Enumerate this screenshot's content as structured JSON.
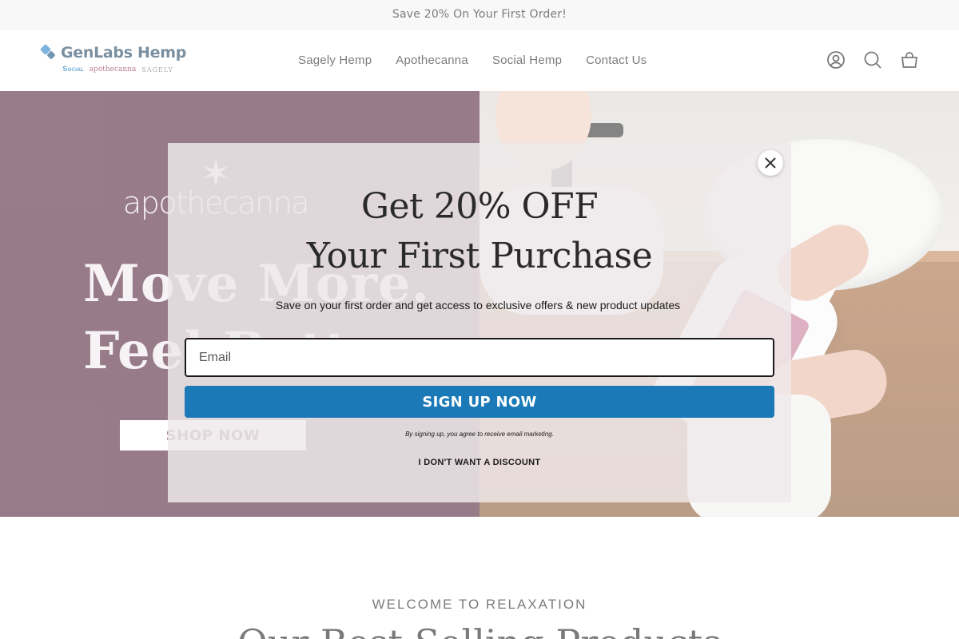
{
  "announcement": {
    "text": "Save 20% On Your First Order!"
  },
  "header": {
    "logo": {
      "name": "GenLabs Hemp",
      "sub_brands": [
        "Social",
        "apothecanna",
        "SAGELY"
      ]
    },
    "nav": [
      {
        "label": "Sagely Hemp"
      },
      {
        "label": "Apothecanna"
      },
      {
        "label": "Social Hemp"
      },
      {
        "label": "Contact Us"
      }
    ],
    "icons": [
      "account-icon",
      "search-icon",
      "cart-icon"
    ]
  },
  "hero": {
    "brand": "apothecanna",
    "headline_line1": "Move More.",
    "headline_line2": "Feel Better.",
    "cta": "SHOP NOW",
    "colors": {
      "panel": "#4e1d33",
      "text": "#f2eaee"
    }
  },
  "modal": {
    "title_line1": "Get 20% OFF",
    "title_line2": "Your First Purchase",
    "subtitle": "Save on your first order and get access to exclusive offers & new product updates",
    "email_placeholder": "Email",
    "email_value": "",
    "signup_label": "SIGN UP NOW",
    "legal": "By signing up, you agree to receive email marketing.",
    "decline_label": "I DON'T WANT A DISCOUNT",
    "colors": {
      "signup": "#1a79b6"
    }
  },
  "section": {
    "eyebrow": "WELCOME TO RELAXATION",
    "title": "Our Best Selling Products"
  }
}
